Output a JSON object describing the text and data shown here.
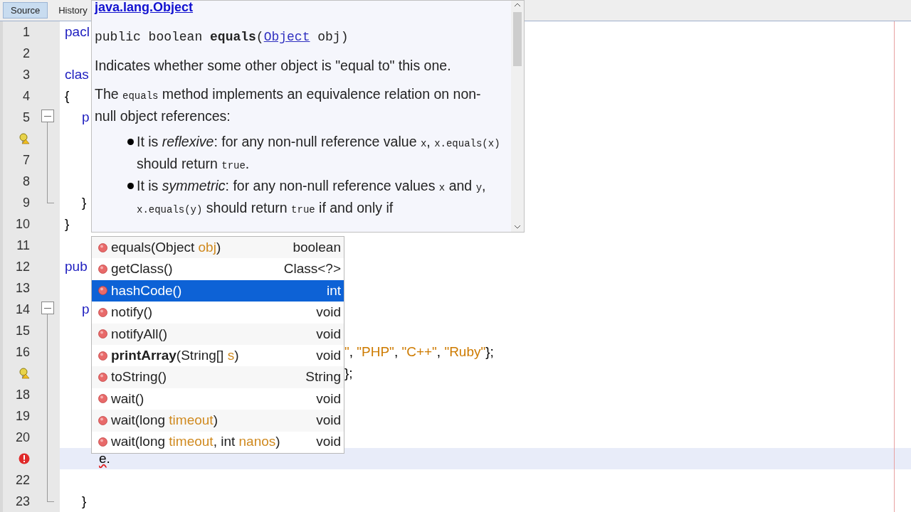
{
  "editor_tabs": [
    {
      "label": "Source",
      "selected": true
    },
    {
      "label": "History",
      "selected": false
    }
  ],
  "code_lines": [
    {
      "kind": "numbered",
      "number": "1",
      "segments": [
        {
          "text": "pacl",
          "kind": "keyword"
        }
      ]
    },
    {
      "kind": "numbered",
      "number": "2"
    },
    {
      "kind": "numbered",
      "number": "3",
      "segments": [
        {
          "text": "clas",
          "kind": "keyword"
        }
      ]
    },
    {
      "kind": "numbered",
      "number": "4",
      "segments": [
        {
          "text": "{",
          "kind": "plain"
        }
      ]
    },
    {
      "kind": "numbered",
      "number": "5",
      "fold_start": true,
      "segments": [
        {
          "text": "p",
          "kind": "keyword"
        }
      ]
    },
    {
      "kind": "warning",
      "in_fold": true
    },
    {
      "kind": "numbered",
      "number": "7",
      "in_fold": true
    },
    {
      "kind": "numbered",
      "number": "8",
      "in_fold": true
    },
    {
      "kind": "numbered",
      "number": "9",
      "fold_end": true,
      "segments": [
        {
          "text": "}",
          "kind": "plain"
        }
      ]
    },
    {
      "kind": "numbered",
      "number": "10",
      "segments": [
        {
          "text": "}",
          "kind": "plain"
        }
      ]
    },
    {
      "kind": "numbered",
      "number": "11"
    },
    {
      "kind": "numbered",
      "number": "12",
      "segments": [
        {
          "text": "pub",
          "kind": "keyword"
        }
      ]
    },
    {
      "kind": "numbered",
      "number": "13"
    },
    {
      "kind": "numbered",
      "number": "14",
      "fold_start": true,
      "segments": [
        {
          "text": "p",
          "kind": "keyword"
        }
      ]
    },
    {
      "kind": "numbered",
      "number": "15",
      "in_fold": true
    },
    {
      "kind": "numbered",
      "number": "16",
      "in_fold": true,
      "covered": true,
      "segments": [
        {
          "text": "\"",
          "kind": "string"
        },
        {
          "text": ", ",
          "kind": "plain"
        },
        {
          "text": "\"PHP\"",
          "kind": "string"
        },
        {
          "text": ", ",
          "kind": "plain"
        },
        {
          "text": "\"C++\"",
          "kind": "string"
        },
        {
          "text": ", ",
          "kind": "plain"
        },
        {
          "text": "\"Ruby\"",
          "kind": "string"
        },
        {
          "text": "};",
          "kind": "plain"
        }
      ]
    },
    {
      "kind": "warning",
      "in_fold": true,
      "covered": true,
      "segments": [
        {
          "text": "};",
          "kind": "plain"
        }
      ]
    },
    {
      "kind": "numbered",
      "number": "18",
      "in_fold": true
    },
    {
      "kind": "numbered",
      "number": "19",
      "in_fold": true
    },
    {
      "kind": "numbered",
      "number": "20",
      "in_fold": true
    },
    {
      "kind": "error",
      "in_fold": true,
      "current": true,
      "segments": [
        {
          "text": "e",
          "kind": "error"
        },
        {
          "text": ".",
          "kind": "plain"
        }
      ]
    },
    {
      "kind": "numbered",
      "number": "22",
      "in_fold": true
    },
    {
      "kind": "numbered",
      "number": "23",
      "fold_end": true,
      "segments": [
        {
          "text": "}",
          "kind": "plain"
        }
      ]
    }
  ],
  "javadoc": {
    "title": "java.lang.Object",
    "signature": [
      {
        "text": "public boolean ",
        "kind": "plain"
      },
      {
        "text": "equals",
        "kind": "bold"
      },
      {
        "text": "(",
        "kind": "plain"
      },
      {
        "text": "Object",
        "kind": "link"
      },
      {
        "text": " obj)",
        "kind": "plain"
      }
    ],
    "blocks": [
      {
        "kind": "para",
        "segments": [
          {
            "text": "Indicates whether some other object is \"equal to\" this one.",
            "kind": "plain"
          }
        ]
      },
      {
        "kind": "para",
        "segments": [
          {
            "text": "The ",
            "kind": "plain"
          },
          {
            "text": "equals",
            "kind": "code"
          },
          {
            "text": " method implements an equivalence relation on non-null object references:",
            "kind": "plain"
          }
        ]
      },
      {
        "kind": "bullet",
        "segments": [
          {
            "text": "It is ",
            "kind": "plain"
          },
          {
            "text": "reflexive",
            "kind": "italic"
          },
          {
            "text": ": for any non-null reference value ",
            "kind": "plain"
          },
          {
            "text": "x",
            "kind": "code"
          },
          {
            "text": ", ",
            "kind": "plain"
          },
          {
            "text": "x.equals(x)",
            "kind": "code"
          },
          {
            "text": " should return ",
            "kind": "plain"
          },
          {
            "text": "true",
            "kind": "code"
          },
          {
            "text": ".",
            "kind": "plain"
          }
        ]
      },
      {
        "kind": "bullet",
        "segments": [
          {
            "text": "It is ",
            "kind": "plain"
          },
          {
            "text": "symmetric",
            "kind": "italic"
          },
          {
            "text": ": for any non-null reference values ",
            "kind": "plain"
          },
          {
            "text": "x",
            "kind": "code"
          },
          {
            "text": " and ",
            "kind": "plain"
          },
          {
            "text": "y",
            "kind": "code"
          },
          {
            "text": ", ",
            "kind": "plain"
          },
          {
            "text": "x.equals(y)",
            "kind": "code"
          },
          {
            "text": " should return ",
            "kind": "plain"
          },
          {
            "text": "true",
            "kind": "code"
          },
          {
            "text": " if and only if",
            "kind": "plain"
          }
        ]
      }
    ]
  },
  "completions": [
    {
      "selected": false,
      "returns": "boolean",
      "segments": [
        {
          "text": "equals(Object ",
          "kind": "plain"
        },
        {
          "text": "obj",
          "kind": "param"
        },
        {
          "text": ")",
          "kind": "plain"
        }
      ]
    },
    {
      "selected": false,
      "returns": "Class<?>",
      "segments": [
        {
          "text": "getClass()",
          "kind": "plain"
        }
      ]
    },
    {
      "selected": true,
      "returns": "int",
      "segments": [
        {
          "text": "hashCode()",
          "kind": "plain"
        }
      ]
    },
    {
      "selected": false,
      "returns": "void",
      "segments": [
        {
          "text": "notify()",
          "kind": "plain"
        }
      ]
    },
    {
      "selected": false,
      "returns": "void",
      "segments": [
        {
          "text": "notifyAll()",
          "kind": "plain"
        }
      ]
    },
    {
      "selected": false,
      "returns": "void",
      "segments": [
        {
          "text": "printArray",
          "kind": "bold"
        },
        {
          "text": "(String[] ",
          "kind": "plain"
        },
        {
          "text": "s",
          "kind": "param"
        },
        {
          "text": ")",
          "kind": "plain"
        }
      ]
    },
    {
      "selected": false,
      "returns": "String",
      "segments": [
        {
          "text": "toString()",
          "kind": "plain"
        }
      ]
    },
    {
      "selected": false,
      "returns": "void",
      "segments": [
        {
          "text": "wait()",
          "kind": "plain"
        }
      ]
    },
    {
      "selected": false,
      "returns": "void",
      "segments": [
        {
          "text": "wait(long ",
          "kind": "plain"
        },
        {
          "text": "timeout",
          "kind": "param"
        },
        {
          "text": ")",
          "kind": "plain"
        }
      ]
    },
    {
      "selected": false,
      "returns": "void",
      "segments": [
        {
          "text": "wait(long ",
          "kind": "plain"
        },
        {
          "text": "timeout",
          "kind": "param"
        },
        {
          "text": ", int ",
          "kind": "plain"
        },
        {
          "text": "nanos",
          "kind": "param"
        },
        {
          "text": ")",
          "kind": "plain"
        }
      ]
    }
  ]
}
